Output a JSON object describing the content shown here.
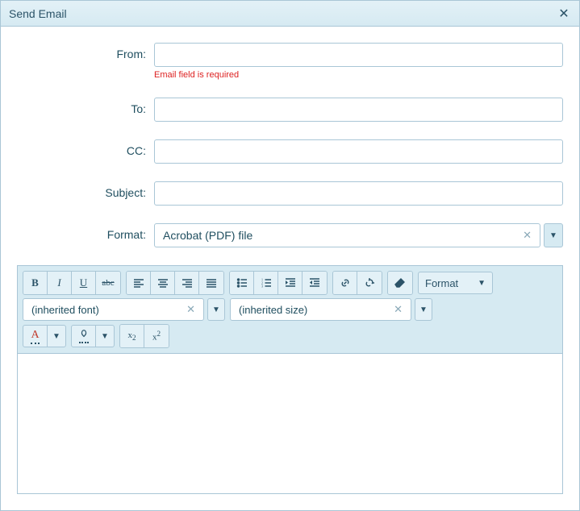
{
  "dialog": {
    "title": "Send Email"
  },
  "form": {
    "from": {
      "label": "From:",
      "value": "",
      "error": "Email field is required"
    },
    "to": {
      "label": "To:",
      "value": ""
    },
    "cc": {
      "label": "CC:",
      "value": ""
    },
    "subject": {
      "label": "Subject:",
      "value": ""
    },
    "format": {
      "label": "Format:",
      "value": "Acrobat (PDF) file"
    }
  },
  "editor": {
    "format_label": "Format",
    "font_value": "(inherited font)",
    "size_value": "(inherited size)"
  }
}
